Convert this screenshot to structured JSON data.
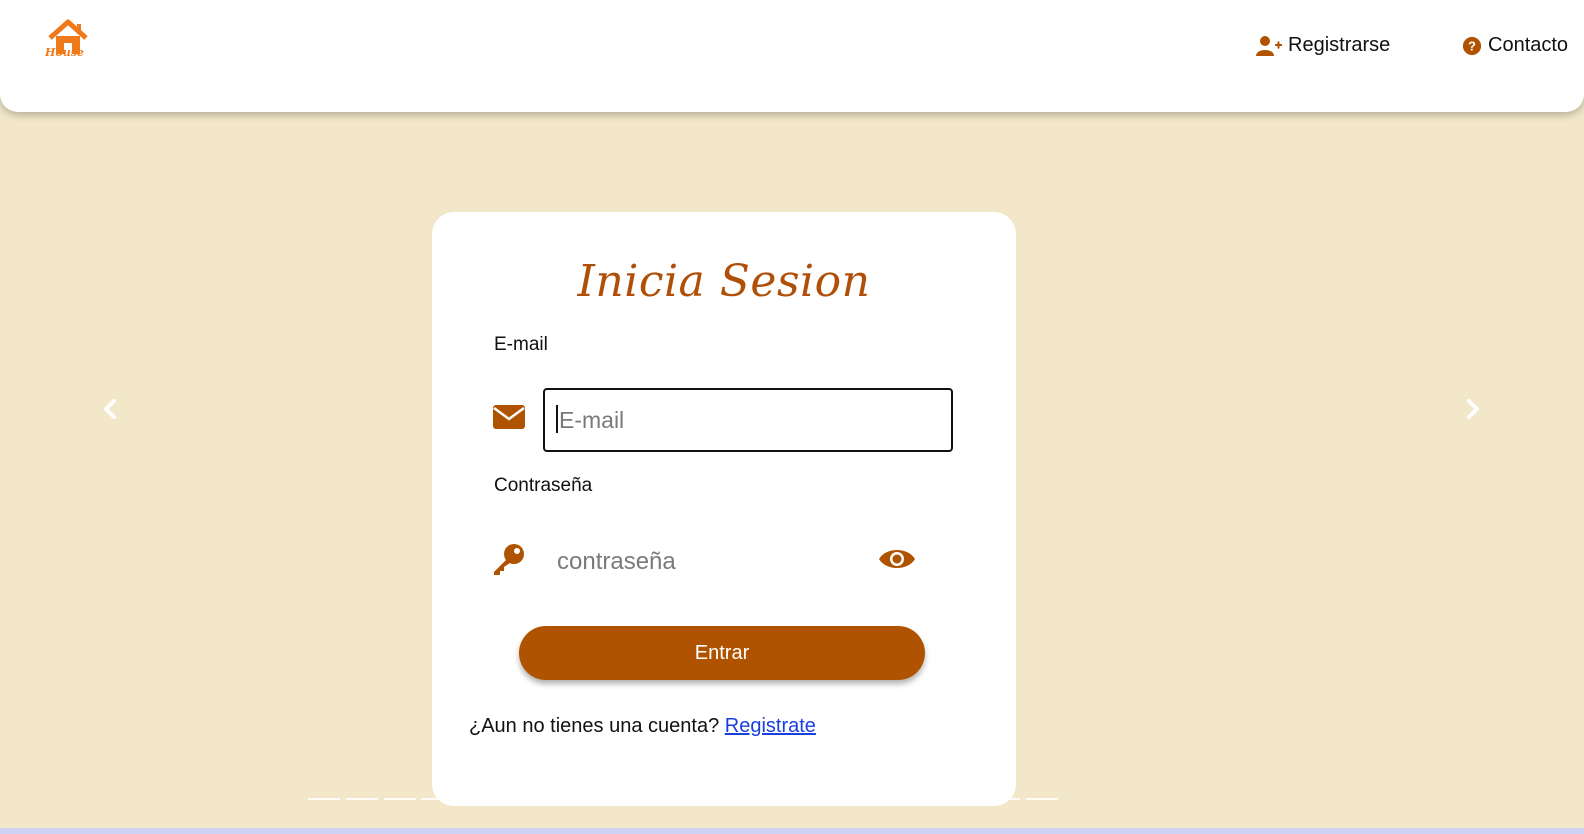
{
  "header": {
    "logo_text": "House",
    "nav": [
      {
        "label": "Registrarse",
        "icon": "user-plus-icon"
      },
      {
        "label": "Contacto",
        "icon": "question-circle-icon"
      }
    ]
  },
  "login": {
    "title": "Inicia Sesion",
    "email_label": "E-mail",
    "email_placeholder": "E-mail",
    "email_value": "",
    "password_label": "Contraseña",
    "password_placeholder": "contraseña",
    "submit_label": "Entrar",
    "signup_prompt": "¿Aun no tienes una cuenta?",
    "signup_link": "Registrate"
  },
  "carousel": {
    "indicator_count": 20,
    "active_index": 5
  },
  "colors": {
    "accent": "#b05300",
    "background": "#f2e7c9",
    "link": "#1a3fe0"
  }
}
